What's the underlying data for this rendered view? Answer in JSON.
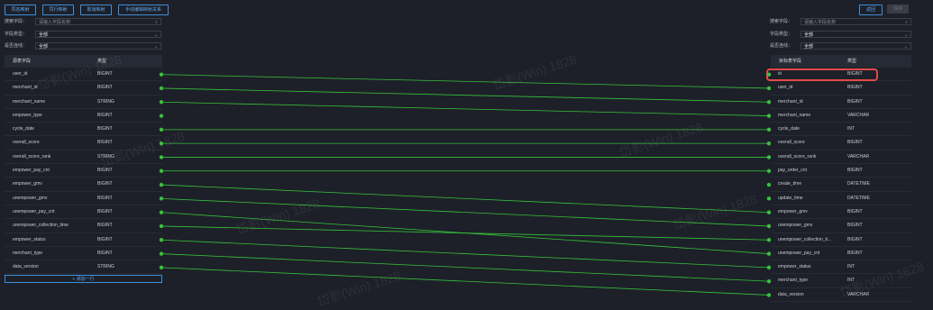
{
  "toolbar": {
    "same_name_label": "同名映射",
    "same_row_label": "同行映射",
    "cancel_label": "取消映射",
    "manual_edit_label": "手动编辑映射关系",
    "back_label": "返回",
    "save_label": "保存"
  },
  "left_filters": {
    "search_label": "搜索字段：",
    "search_placeholder": "请输入字段名称",
    "type_label": "字段类型：",
    "type_value": "全部",
    "selected_label": "是否连线：",
    "selected_value": "全部"
  },
  "right_filters": {
    "search_label": "搜索字段：",
    "search_placeholder": "请输入字段名称",
    "type_label": "字段类型：",
    "type_value": "全部",
    "selected_label": "是否连线：",
    "selected_value": "全部"
  },
  "source": {
    "header_field": "源表字段",
    "header_type": "类型",
    "rows": [
      {
        "name": "user_id",
        "type": "BIGINT"
      },
      {
        "name": "merchant_id",
        "type": "BIGINT"
      },
      {
        "name": "merchant_name",
        "type": "STRING"
      },
      {
        "name": "empower_type",
        "type": "BIGINT"
      },
      {
        "name": "cycle_date",
        "type": "BIGINT"
      },
      {
        "name": "overall_score",
        "type": "BIGINT"
      },
      {
        "name": "overall_score_rank",
        "type": "STRING"
      },
      {
        "name": "empower_pay_cnt",
        "type": "BIGINT"
      },
      {
        "name": "empower_gmv",
        "type": "BIGINT"
      },
      {
        "name": "unempower_gmv",
        "type": "BIGINT"
      },
      {
        "name": "unempower_pay_cnt",
        "type": "BIGINT"
      },
      {
        "name": "unempower_collection_time",
        "type": "BIGINT"
      },
      {
        "name": "empower_status",
        "type": "BIGINT"
      },
      {
        "name": "merchant_type",
        "type": "BIGINT"
      },
      {
        "name": "data_version",
        "type": "STRING"
      }
    ],
    "add_row_label": "+ 添加一行"
  },
  "target": {
    "header_field": "目标表字段",
    "header_type": "类型",
    "rows": [
      {
        "name": "id",
        "type": "BIGINT"
      },
      {
        "name": "user_id",
        "type": "BIGINT"
      },
      {
        "name": "merchant_id",
        "type": "BIGINT"
      },
      {
        "name": "merchant_name",
        "type": "VARCHAR"
      },
      {
        "name": "cycle_date",
        "type": "INT"
      },
      {
        "name": "overall_score",
        "type": "BIGINT"
      },
      {
        "name": "overall_score_rank",
        "type": "VARCHAR"
      },
      {
        "name": "pay_order_cnt",
        "type": "BIGINT"
      },
      {
        "name": "create_time",
        "type": "DATETIME"
      },
      {
        "name": "update_time",
        "type": "DATETIME"
      },
      {
        "name": "empower_gmv",
        "type": "BIGINT"
      },
      {
        "name": "unempower_gmv",
        "type": "BIGINT"
      },
      {
        "name": "unempower_collection_ti...",
        "type": "BIGINT"
      },
      {
        "name": "unempower_pay_cnt",
        "type": "BIGINT"
      },
      {
        "name": "empower_status",
        "type": "INT"
      },
      {
        "name": "merchant_type",
        "type": "INT"
      },
      {
        "name": "data_version",
        "type": "VARCHAR"
      }
    ]
  },
  "mappings": [
    [
      0,
      1
    ],
    [
      1,
      2
    ],
    [
      2,
      3
    ],
    [
      4,
      4
    ],
    [
      5,
      5
    ],
    [
      6,
      6
    ],
    [
      7,
      7
    ],
    [
      8,
      10
    ],
    [
      9,
      11
    ],
    [
      10,
      13
    ],
    [
      11,
      12
    ],
    [
      12,
      14
    ],
    [
      13,
      15
    ],
    [
      14,
      16
    ]
  ],
  "watermark": "岱影(Win) 1828",
  "colors": {
    "accent": "#3f8fd9",
    "line": "#37c23a",
    "highlight": "#e34a4a"
  }
}
